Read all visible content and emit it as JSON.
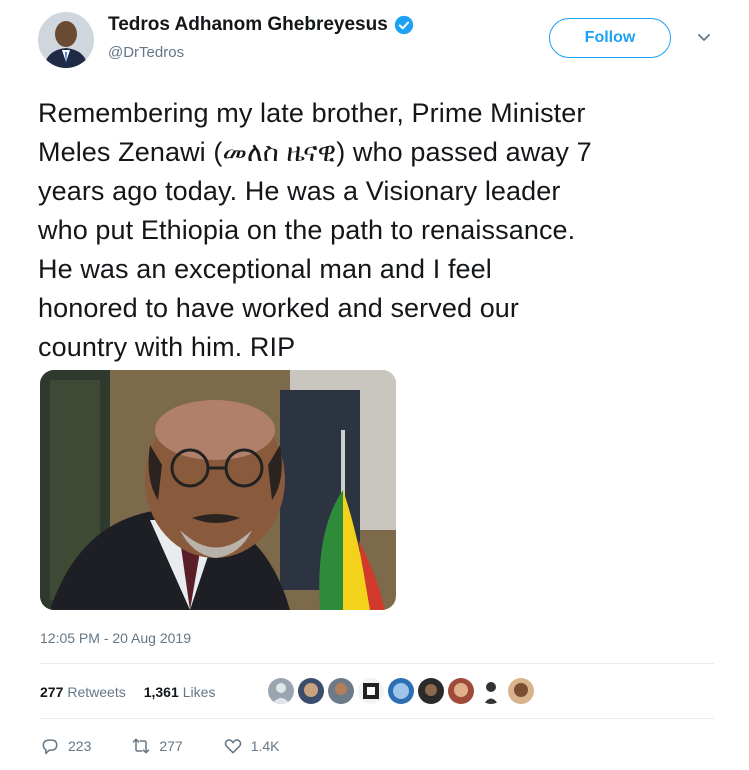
{
  "author": {
    "name": "Tedros Adhanom Ghebreyesus",
    "handle": "@DrTedros",
    "verified": true
  },
  "follow_button": {
    "label": "Follow"
  },
  "tweet": {
    "lines": [
      "Remembering my late brother, Prime Minister",
      "Meles Zenawi (መለስ ዜናዊ) who passed away 7",
      "years ago today. He was a Visionary leader",
      "who put Ethiopia on the path to renaissance.",
      "He was an exceptional man and I feel",
      "honored to have worked and served our",
      "country with him. RIP"
    ],
    "timestamp": "12:05 PM - 20 Aug 2019"
  },
  "stats": {
    "retweets_count": "277",
    "retweets_label": "Retweets",
    "likes_count": "1,361",
    "likes_label": "Likes"
  },
  "actions": {
    "replies": "223",
    "retweets": "277",
    "likes": "1.4K"
  },
  "colors": {
    "accent": "#1da1f2",
    "text": "#14171a",
    "muted": "#657786"
  }
}
